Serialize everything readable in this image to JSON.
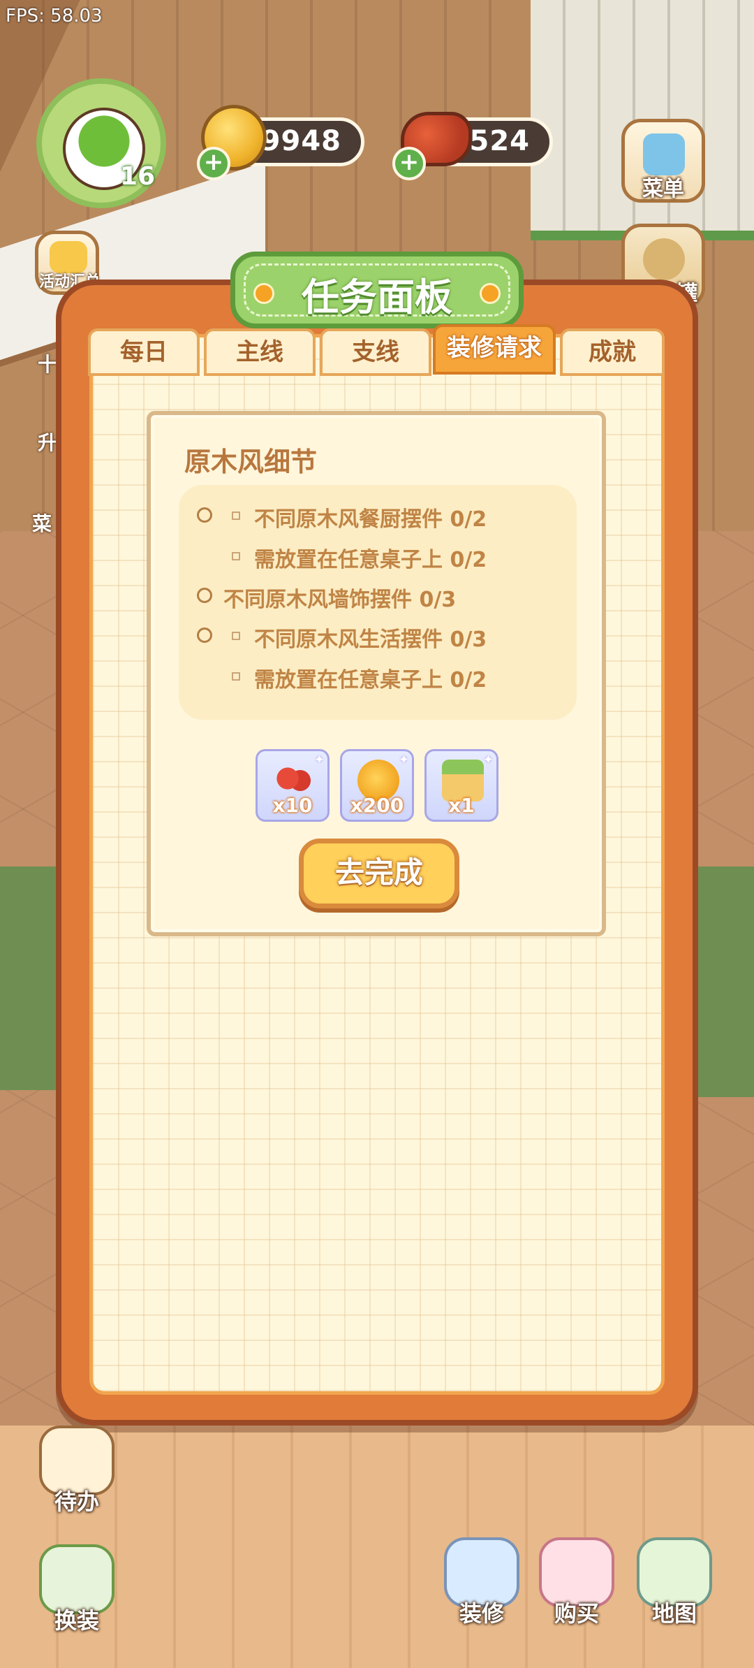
{
  "fps": "FPS: 58.03",
  "player": {
    "level": "16"
  },
  "currency": {
    "coins": "9948",
    "meat": "2524"
  },
  "left_menu": [
    {
      "label": "活动汇总"
    },
    {
      "label": "十"
    },
    {
      "label": "升"
    },
    {
      "label": "菜"
    }
  ],
  "right_menu": [
    {
      "label": "菜单"
    },
    {
      "label": "罐"
    }
  ],
  "panel": {
    "title": "任务面板",
    "tabs": [
      "每日",
      "主线",
      "支线",
      "装修请求",
      "成就"
    ],
    "active_tab": "装修请求"
  },
  "task": {
    "title": "原木风细节",
    "requirements": [
      {
        "text": "不同原木风餐厨摆件 0/2",
        "level": 1
      },
      {
        "text": "需放置在任意桌子上 0/2",
        "level": 2
      },
      {
        "text": "不同原木风墙饰摆件 0/3",
        "level": 1
      },
      {
        "text": "不同原木风生活摆件 0/3",
        "level": 1
      },
      {
        "text": "需放置在任意桌子上 0/2",
        "level": 2
      }
    ],
    "rewards": [
      {
        "icon": "cherry-icon",
        "qty": "x10"
      },
      {
        "icon": "gold-coins-icon",
        "qty": "x200"
      },
      {
        "icon": "gift-box-icon",
        "qty": "x1"
      }
    ],
    "button": "去完成"
  },
  "bottom_left": [
    {
      "label": "待办"
    },
    {
      "label": "换装"
    }
  ],
  "bottom_right": [
    {
      "label": "装修"
    },
    {
      "label": "购买"
    },
    {
      "label": "地图"
    }
  ],
  "colors": {
    "panel_orange": "#e07b3a",
    "tab_active": "#f6a53b",
    "title_green": "#9cd26b",
    "task_text": "#c08445",
    "button_yellow": "#ffd05a"
  }
}
